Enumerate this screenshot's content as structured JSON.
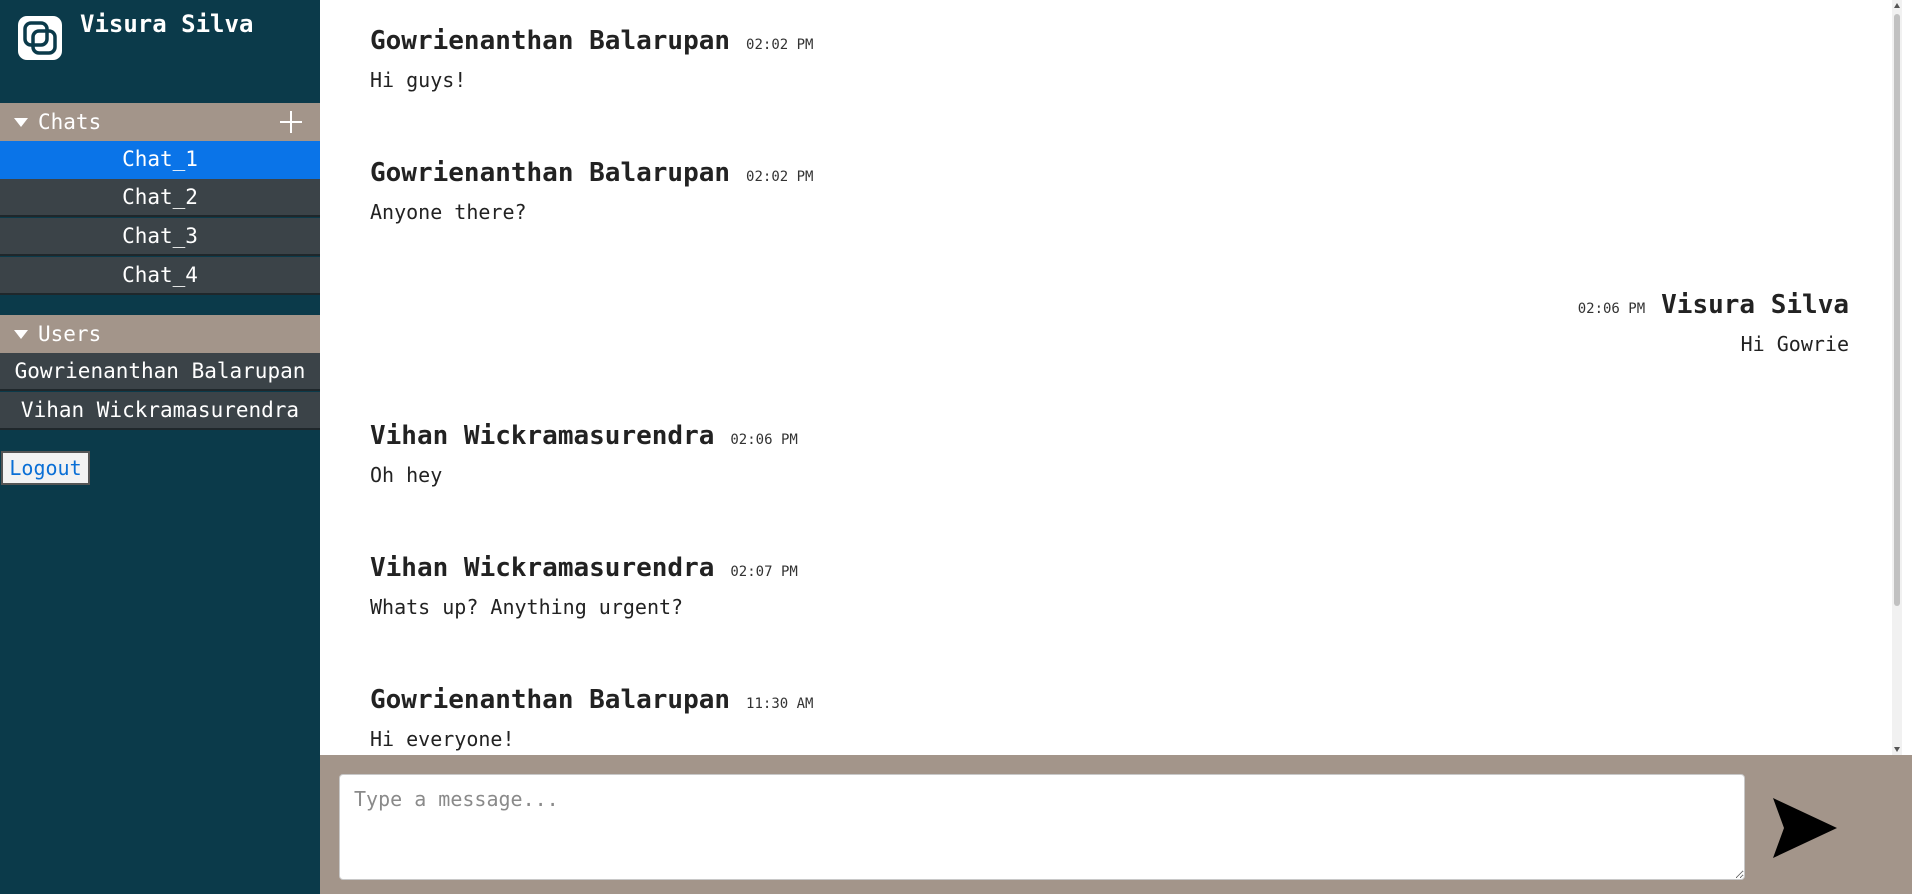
{
  "user": {
    "name": "Visura Silva"
  },
  "sidebar": {
    "chats_header": "Chats",
    "chats": [
      {
        "label": "Chat_1",
        "active": true
      },
      {
        "label": "Chat_2",
        "active": false
      },
      {
        "label": "Chat_3",
        "active": false
      },
      {
        "label": "Chat_4",
        "active": false
      }
    ],
    "users_header": "Users",
    "users": [
      {
        "label": "Gowrienanthan Balarupan"
      },
      {
        "label": "Vihan Wickramasurendra"
      }
    ],
    "logout_label": "Logout"
  },
  "messages": [
    {
      "sender": "Gowrienanthan Balarupan",
      "time": "02:02 PM",
      "text": "Hi guys!",
      "own": false
    },
    {
      "sender": "Gowrienanthan Balarupan",
      "time": "02:02 PM",
      "text": "Anyone there?",
      "own": false
    },
    {
      "sender": "Visura Silva",
      "time": "02:06 PM",
      "text": "Hi Gowrie",
      "own": true
    },
    {
      "sender": "Vihan Wickramasurendra",
      "time": "02:06 PM",
      "text": "Oh hey",
      "own": false
    },
    {
      "sender": "Vihan Wickramasurendra",
      "time": "02:07 PM",
      "text": "Whats up? Anything urgent?",
      "own": false
    },
    {
      "sender": "Gowrienanthan Balarupan",
      "time": "11:30 AM",
      "text": "Hi everyone!",
      "own": false
    }
  ],
  "composer": {
    "placeholder": "Type a message...",
    "value": ""
  },
  "icons": {
    "brand": "chat-logo-icon",
    "add_chat": "plus-icon",
    "collapse": "caret-down-icon",
    "send": "send-arrow-icon"
  },
  "colors": {
    "sidebar_bg": "#0b3a4a",
    "section_header_bg": "#a3958a",
    "list_item_bg": "#3b4348",
    "active_item_bg": "#0a74e8",
    "composer_bg": "#a3958a"
  }
}
